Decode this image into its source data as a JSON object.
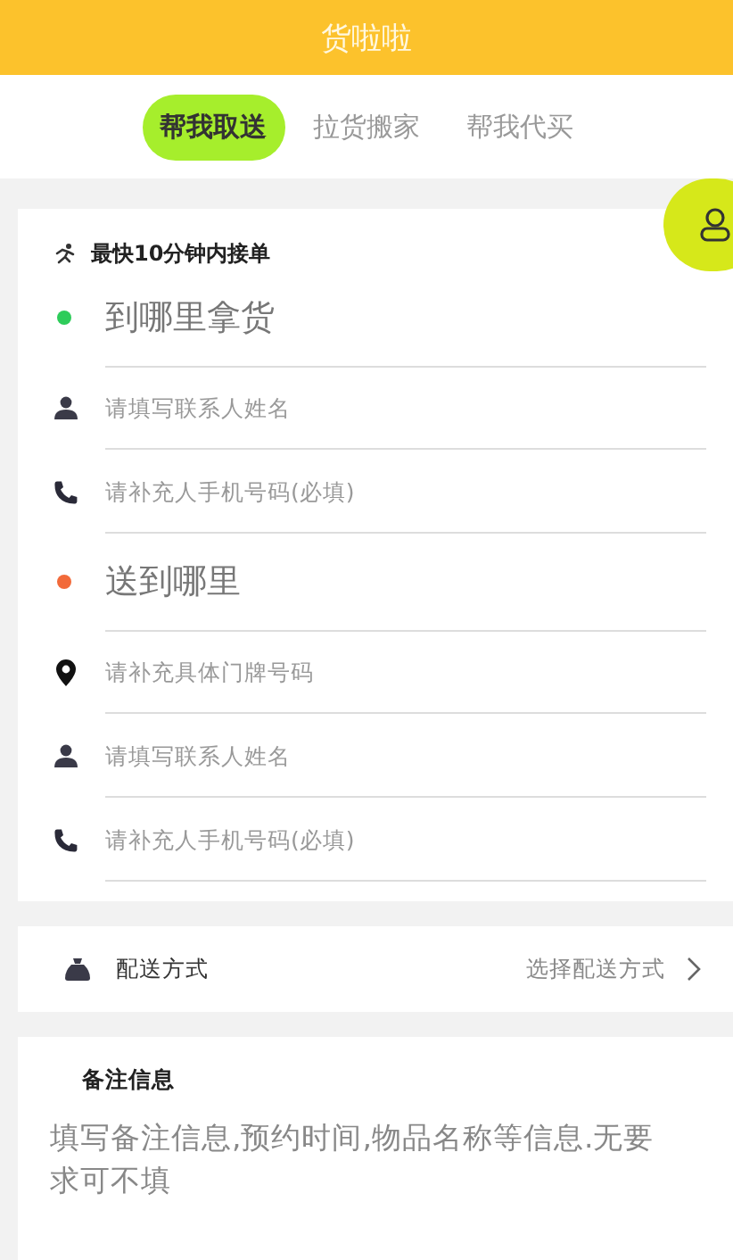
{
  "header": {
    "title": "货啦啦"
  },
  "tabs": [
    {
      "label": "帮我取送",
      "selected": true
    },
    {
      "label": "拉货搬家",
      "selected": false
    },
    {
      "label": "帮我代买",
      "selected": false
    }
  ],
  "order_card": {
    "notice": "最快10分钟内接单",
    "sections": [
      {
        "heading": {
          "placeholder": "到哪里拿货",
          "color": "#2ecc5a"
        },
        "fields": [
          {
            "kind": "person",
            "placeholder": "请填写联系人姓名"
          },
          {
            "kind": "phone",
            "placeholder": "请补充人手机号码(必填)"
          }
        ]
      },
      {
        "heading": {
          "placeholder": "送到哪里",
          "color": "#f26a3a"
        },
        "fields": [
          {
            "kind": "location",
            "placeholder": "请补充具体门牌号码"
          },
          {
            "kind": "person",
            "placeholder": "请填写联系人姓名"
          },
          {
            "kind": "phone",
            "placeholder": "请补充人手机号码(必填)"
          }
        ]
      }
    ]
  },
  "delivery": {
    "label": "配送方式",
    "value": "选择配送方式"
  },
  "notes": {
    "title": "备注信息",
    "placeholder": "填写备注信息,预约时间,物品名称等信息.无要求可不填"
  }
}
